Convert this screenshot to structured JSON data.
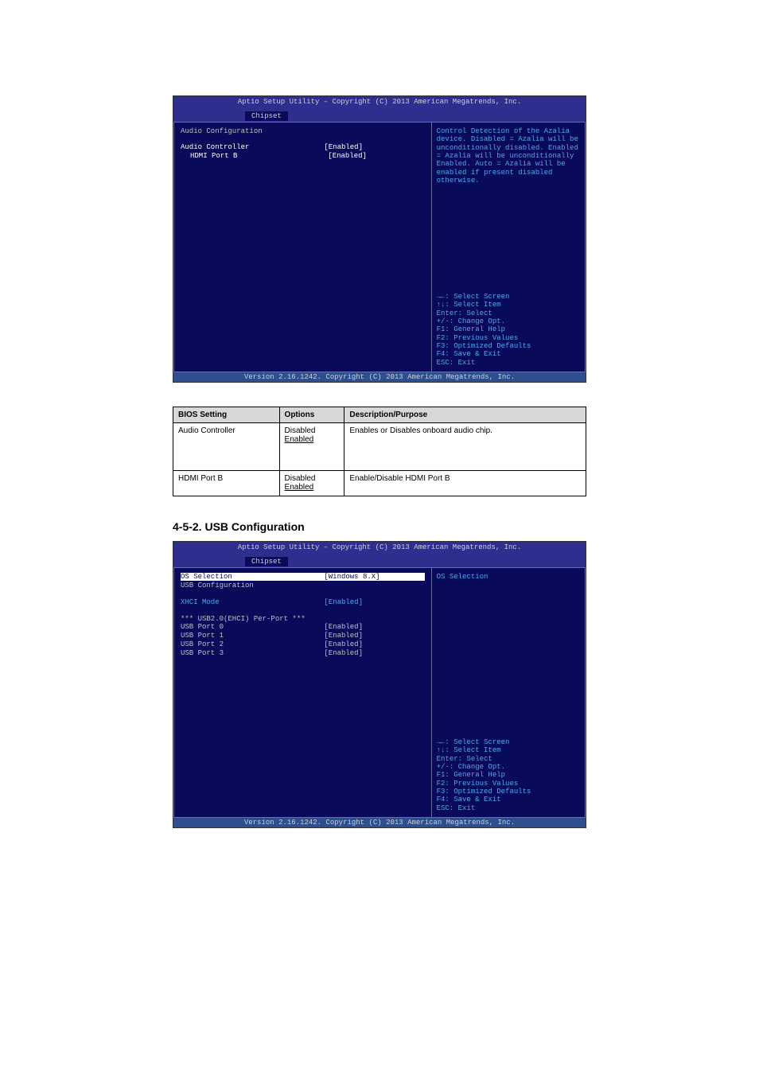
{
  "bios1": {
    "title": "Aptio Setup Utility – Copyright (C) 2013 American Megatrends, Inc.",
    "tab": "Chipset",
    "header": "Audio Configuration",
    "rows": [
      {
        "label": "Audio Controller",
        "value": "[Enabled]",
        "highlight": true
      },
      {
        "label": "HDMI Port B",
        "value": "[Enabled]",
        "highlight": true,
        "indent": true
      }
    ],
    "help_text": "Control Detection of the Azalia device.   Disabled = Azalia will be unconditionally disabled.   Enabled = Azalia will be unconditionally Enabled.   Auto = Azalia will be enabled if present disabled otherwise.",
    "nav_help": [
      "→←: Select Screen",
      "↑↓: Select Item",
      "Enter: Select",
      "+/-: Change Opt.",
      "F1: General Help",
      "F2: Previous Values",
      "F3: Optimized Defaults",
      "F4: Save & Exit",
      "ESC: Exit"
    ],
    "footer": "Version 2.16.1242. Copyright (C) 2013 American Megatrends, Inc."
  },
  "table": {
    "headers": [
      "BIOS Setting",
      "Options",
      "Description/Purpose"
    ],
    "rows": [
      {
        "setting": "Audio Controller",
        "options_pre": "Disabled\n",
        "options_default": "Enabled",
        "desc": "Enables or Disables onboard audio chip."
      },
      {
        "setting": "HDMI Port B",
        "options_pre": "Disabled\n",
        "options_default": "Enabled",
        "desc": "Enable/Disable HDMI Port B"
      }
    ]
  },
  "heading": "4-5-2. USB Configuration",
  "bios2": {
    "title": "Aptio Setup Utility – Copyright (C) 2013 American Megatrends, Inc.",
    "tab": "Chipset",
    "selected": {
      "label": "OS Selection",
      "value": "[Windows 8.X]"
    },
    "rows1": [
      {
        "label": "USB Configuration",
        "value": ""
      }
    ],
    "xhci": {
      "label": "XHCI Mode",
      "value": "[Enabled]"
    },
    "sub_header": "*** USB2.0(EHCI) Per-Port ***",
    "rows2": [
      {
        "label": "USB Port 0",
        "value": "[Enabled]"
      },
      {
        "label": "USB Port 1",
        "value": "[Enabled]"
      },
      {
        "label": "USB Port 2",
        "value": "[Enabled]"
      },
      {
        "label": "USB Port 3",
        "value": "[Enabled]"
      }
    ],
    "help_text": "OS Selection",
    "nav_help": [
      "→←: Select Screen",
      "↑↓: Select Item",
      "Enter: Select",
      "+/-: Change Opt.",
      "F1: General Help",
      "F2: Previous Values",
      "F3: Optimized Defaults",
      "F4: Save & Exit",
      "ESC: Exit"
    ],
    "footer": "Version 2.16.1242. Copyright (C) 2013 American Megatrends, Inc."
  }
}
